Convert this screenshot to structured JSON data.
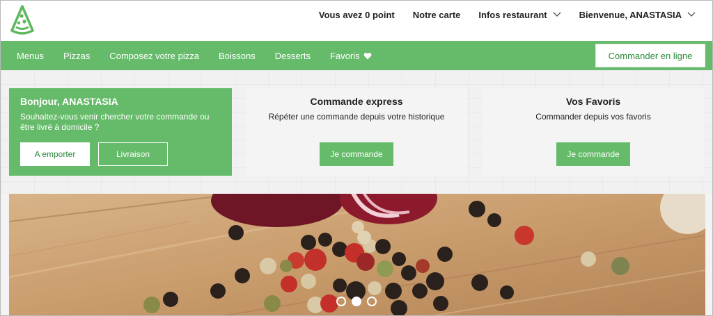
{
  "topnav": {
    "points": "Vous avez 0 point",
    "carte": "Notre carte",
    "infos": "Infos restaurant",
    "welcome": "Bienvenue, ANASTASIA"
  },
  "nav": {
    "items": [
      "Menus",
      "Pizzas",
      "Composez votre pizza",
      "Boissons",
      "Desserts",
      "Favoris"
    ],
    "order_button": "Commander en ligne"
  },
  "cards": {
    "greeting": {
      "title": "Bonjour, ANASTASIA",
      "desc": "Souhaitez-vous venir chercher votre commande ou être livré à domicile ?",
      "btn_takeaway": "A emporter",
      "btn_delivery": "Livraison"
    },
    "express": {
      "title": "Commande express",
      "desc": "Répéter une commande depuis votre historique",
      "button": "Je commande"
    },
    "favorites": {
      "title": "Vos Favoris",
      "desc": "Commander depuis vos favoris",
      "button": "Je commande"
    }
  },
  "carousel": {
    "slides": 3,
    "active_index": 1
  },
  "colors": {
    "brand_green": "#66bb6a",
    "text_dark": "#222222"
  },
  "icons": [
    "pizza-logo-icon",
    "chevron-down-icon",
    "heart-icon"
  ]
}
